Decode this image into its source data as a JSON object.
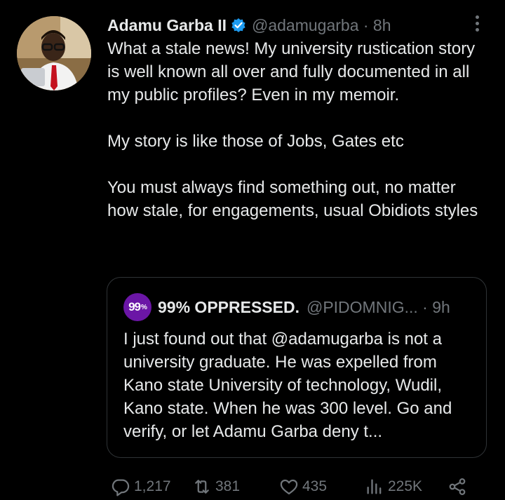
{
  "tweet": {
    "author_name": "Adamu Garba II",
    "handle_time": "@adamugarba · 8h",
    "text": "What a stale news! My university rustication story is well known all over and fully documented in all my public profiles? Even in my memoir.\n\nMy story is like those of Jobs, Gates etc\n\nYou must always find something out, no matter how stale, for engagements, usual Obidiots styles"
  },
  "quoted": {
    "avatar_text": "99",
    "avatar_sup": "%",
    "author_name": "99% OPPRESSED.",
    "handle_time": "@PIDOMNIG... · 9h",
    "text": "I just found out that @adamugarba is not a university graduate. He was expelled from Kano state University of technology, Wudil, Kano state. When he was 300 level. Go and verify, or let Adamu Garba deny t..."
  },
  "actions": {
    "replies": "1,217",
    "reposts": "381",
    "likes": "435",
    "views": "225K"
  },
  "icons": {
    "verified": "verified-badge-icon",
    "more": "more-icon",
    "reply": "reply-icon",
    "repost": "repost-icon",
    "like": "heart-icon",
    "views": "views-icon",
    "share": "share-icon"
  },
  "colors": {
    "background": "#000000",
    "text": "#e7e9ea",
    "secondary": "#71767b",
    "verified": "#1d9bf0",
    "quote_avatar": "#6b16a6"
  }
}
